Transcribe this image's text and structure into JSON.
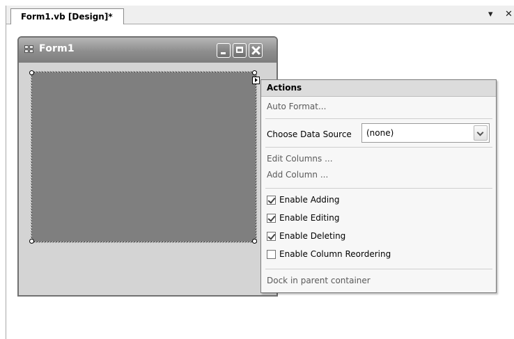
{
  "tab": {
    "title": "Form1.vb [Design]*",
    "pin_glyph": "▾",
    "close_glyph": "✕"
  },
  "form": {
    "title": "Form1"
  },
  "actions": {
    "header": "Actions",
    "auto_format": "Auto Format...",
    "choose_data_source_label": "Choose Data Source",
    "data_source_value": "(none)",
    "edit_columns": "Edit Columns ...",
    "add_column": "Add Column ...",
    "checkboxes": [
      {
        "label": "Enable Adding",
        "checked": true
      },
      {
        "label": "Enable Editing",
        "checked": true
      },
      {
        "label": "Enable Deleting",
        "checked": true
      },
      {
        "label": "Enable Column Reordering",
        "checked": false
      }
    ],
    "dock": "Dock in parent container"
  }
}
